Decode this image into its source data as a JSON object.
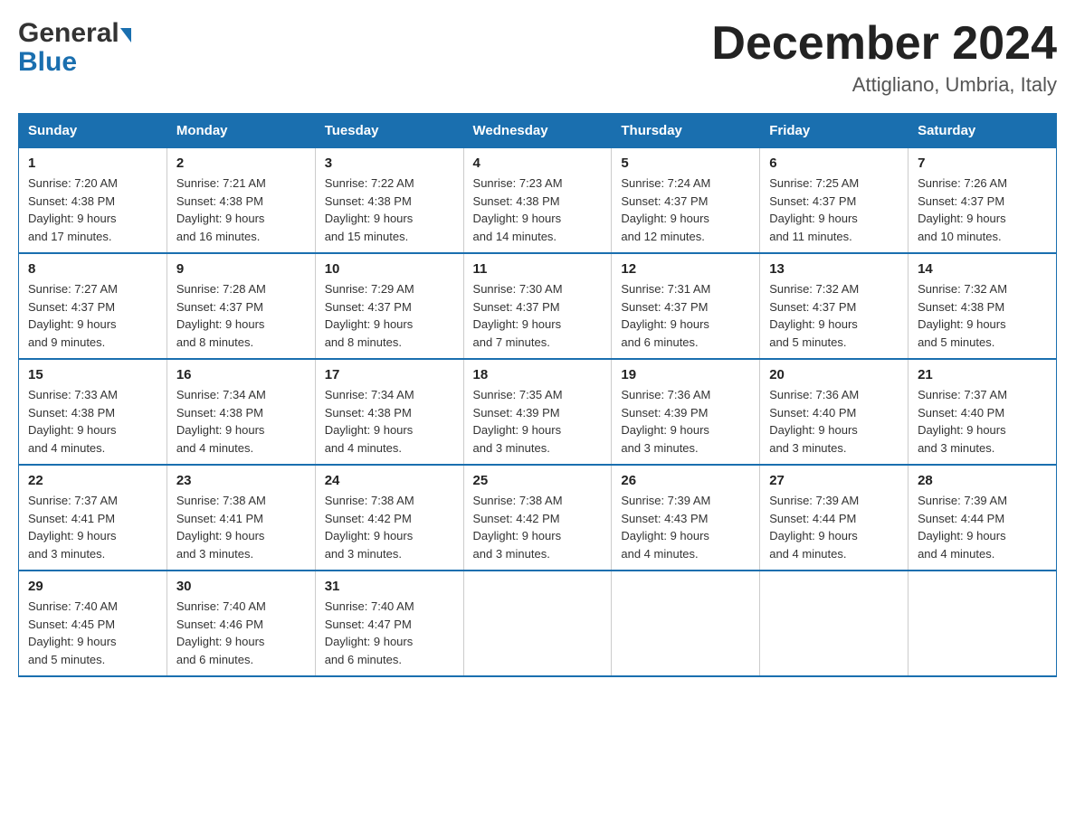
{
  "logo": {
    "general": "General",
    "blue": "Blue"
  },
  "title": "December 2024",
  "subtitle": "Attigliano, Umbria, Italy",
  "days_of_week": [
    "Sunday",
    "Monday",
    "Tuesday",
    "Wednesday",
    "Thursday",
    "Friday",
    "Saturday"
  ],
  "weeks": [
    [
      {
        "day": "1",
        "sunrise": "7:20 AM",
        "sunset": "4:38 PM",
        "daylight": "9 hours and 17 minutes."
      },
      {
        "day": "2",
        "sunrise": "7:21 AM",
        "sunset": "4:38 PM",
        "daylight": "9 hours and 16 minutes."
      },
      {
        "day": "3",
        "sunrise": "7:22 AM",
        "sunset": "4:38 PM",
        "daylight": "9 hours and 15 minutes."
      },
      {
        "day": "4",
        "sunrise": "7:23 AM",
        "sunset": "4:38 PM",
        "daylight": "9 hours and 14 minutes."
      },
      {
        "day": "5",
        "sunrise": "7:24 AM",
        "sunset": "4:37 PM",
        "daylight": "9 hours and 12 minutes."
      },
      {
        "day": "6",
        "sunrise": "7:25 AM",
        "sunset": "4:37 PM",
        "daylight": "9 hours and 11 minutes."
      },
      {
        "day": "7",
        "sunrise": "7:26 AM",
        "sunset": "4:37 PM",
        "daylight": "9 hours and 10 minutes."
      }
    ],
    [
      {
        "day": "8",
        "sunrise": "7:27 AM",
        "sunset": "4:37 PM",
        "daylight": "9 hours and 9 minutes."
      },
      {
        "day": "9",
        "sunrise": "7:28 AM",
        "sunset": "4:37 PM",
        "daylight": "9 hours and 8 minutes."
      },
      {
        "day": "10",
        "sunrise": "7:29 AM",
        "sunset": "4:37 PM",
        "daylight": "9 hours and 8 minutes."
      },
      {
        "day": "11",
        "sunrise": "7:30 AM",
        "sunset": "4:37 PM",
        "daylight": "9 hours and 7 minutes."
      },
      {
        "day": "12",
        "sunrise": "7:31 AM",
        "sunset": "4:37 PM",
        "daylight": "9 hours and 6 minutes."
      },
      {
        "day": "13",
        "sunrise": "7:32 AM",
        "sunset": "4:37 PM",
        "daylight": "9 hours and 5 minutes."
      },
      {
        "day": "14",
        "sunrise": "7:32 AM",
        "sunset": "4:38 PM",
        "daylight": "9 hours and 5 minutes."
      }
    ],
    [
      {
        "day": "15",
        "sunrise": "7:33 AM",
        "sunset": "4:38 PM",
        "daylight": "9 hours and 4 minutes."
      },
      {
        "day": "16",
        "sunrise": "7:34 AM",
        "sunset": "4:38 PM",
        "daylight": "9 hours and 4 minutes."
      },
      {
        "day": "17",
        "sunrise": "7:34 AM",
        "sunset": "4:38 PM",
        "daylight": "9 hours and 4 minutes."
      },
      {
        "day": "18",
        "sunrise": "7:35 AM",
        "sunset": "4:39 PM",
        "daylight": "9 hours and 3 minutes."
      },
      {
        "day": "19",
        "sunrise": "7:36 AM",
        "sunset": "4:39 PM",
        "daylight": "9 hours and 3 minutes."
      },
      {
        "day": "20",
        "sunrise": "7:36 AM",
        "sunset": "4:40 PM",
        "daylight": "9 hours and 3 minutes."
      },
      {
        "day": "21",
        "sunrise": "7:37 AM",
        "sunset": "4:40 PM",
        "daylight": "9 hours and 3 minutes."
      }
    ],
    [
      {
        "day": "22",
        "sunrise": "7:37 AM",
        "sunset": "4:41 PM",
        "daylight": "9 hours and 3 minutes."
      },
      {
        "day": "23",
        "sunrise": "7:38 AM",
        "sunset": "4:41 PM",
        "daylight": "9 hours and 3 minutes."
      },
      {
        "day": "24",
        "sunrise": "7:38 AM",
        "sunset": "4:42 PM",
        "daylight": "9 hours and 3 minutes."
      },
      {
        "day": "25",
        "sunrise": "7:38 AM",
        "sunset": "4:42 PM",
        "daylight": "9 hours and 3 minutes."
      },
      {
        "day": "26",
        "sunrise": "7:39 AM",
        "sunset": "4:43 PM",
        "daylight": "9 hours and 4 minutes."
      },
      {
        "day": "27",
        "sunrise": "7:39 AM",
        "sunset": "4:44 PM",
        "daylight": "9 hours and 4 minutes."
      },
      {
        "day": "28",
        "sunrise": "7:39 AM",
        "sunset": "4:44 PM",
        "daylight": "9 hours and 4 minutes."
      }
    ],
    [
      {
        "day": "29",
        "sunrise": "7:40 AM",
        "sunset": "4:45 PM",
        "daylight": "9 hours and 5 minutes."
      },
      {
        "day": "30",
        "sunrise": "7:40 AM",
        "sunset": "4:46 PM",
        "daylight": "9 hours and 6 minutes."
      },
      {
        "day": "31",
        "sunrise": "7:40 AM",
        "sunset": "4:47 PM",
        "daylight": "9 hours and 6 minutes."
      },
      null,
      null,
      null,
      null
    ]
  ],
  "labels": {
    "sunrise": "Sunrise:",
    "sunset": "Sunset:",
    "daylight": "Daylight:"
  }
}
